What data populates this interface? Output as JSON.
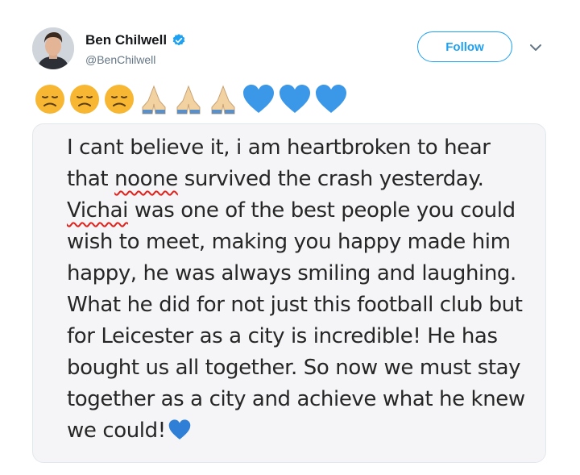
{
  "tweet": {
    "author": {
      "display_name": "Ben Chilwell",
      "handle": "@BenChilwell",
      "verified": true
    },
    "follow_label": "Follow",
    "emoji_row": [
      "disappointed-face",
      "disappointed-face",
      "disappointed-face",
      "folded-hands",
      "folded-hands",
      "folded-hands",
      "blue-heart",
      "blue-heart",
      "blue-heart"
    ],
    "image_text": {
      "line1": "I cant believe it, i am heartbroken to hear",
      "line2_pre": "that ",
      "line2_misspelled": "noone",
      "line2_post": " survived the crash yesterday.",
      "line3_misspelled": "Vichai",
      "line3_post": " was one of the best people you could",
      "line4": "wish to meet, making you happy made him",
      "line5": "happy, he was always smiling and laughing.",
      "line6": "What he did for not just this football club but",
      "line7": "for Leicester as a city is incredible! He has",
      "line8": "bought us all together. So now we must stay",
      "line9": "together as a city and achieve what he knew",
      "line10": "we could!",
      "trailing_emoji": "blue-heart"
    }
  },
  "colors": {
    "accent": "#1da1f2",
    "text": "#14171a",
    "muted": "#657786",
    "heart": "#3b97e8",
    "face": "#f7b733",
    "hands": "#f3d2a2",
    "spellcheck": "#e0211c"
  }
}
